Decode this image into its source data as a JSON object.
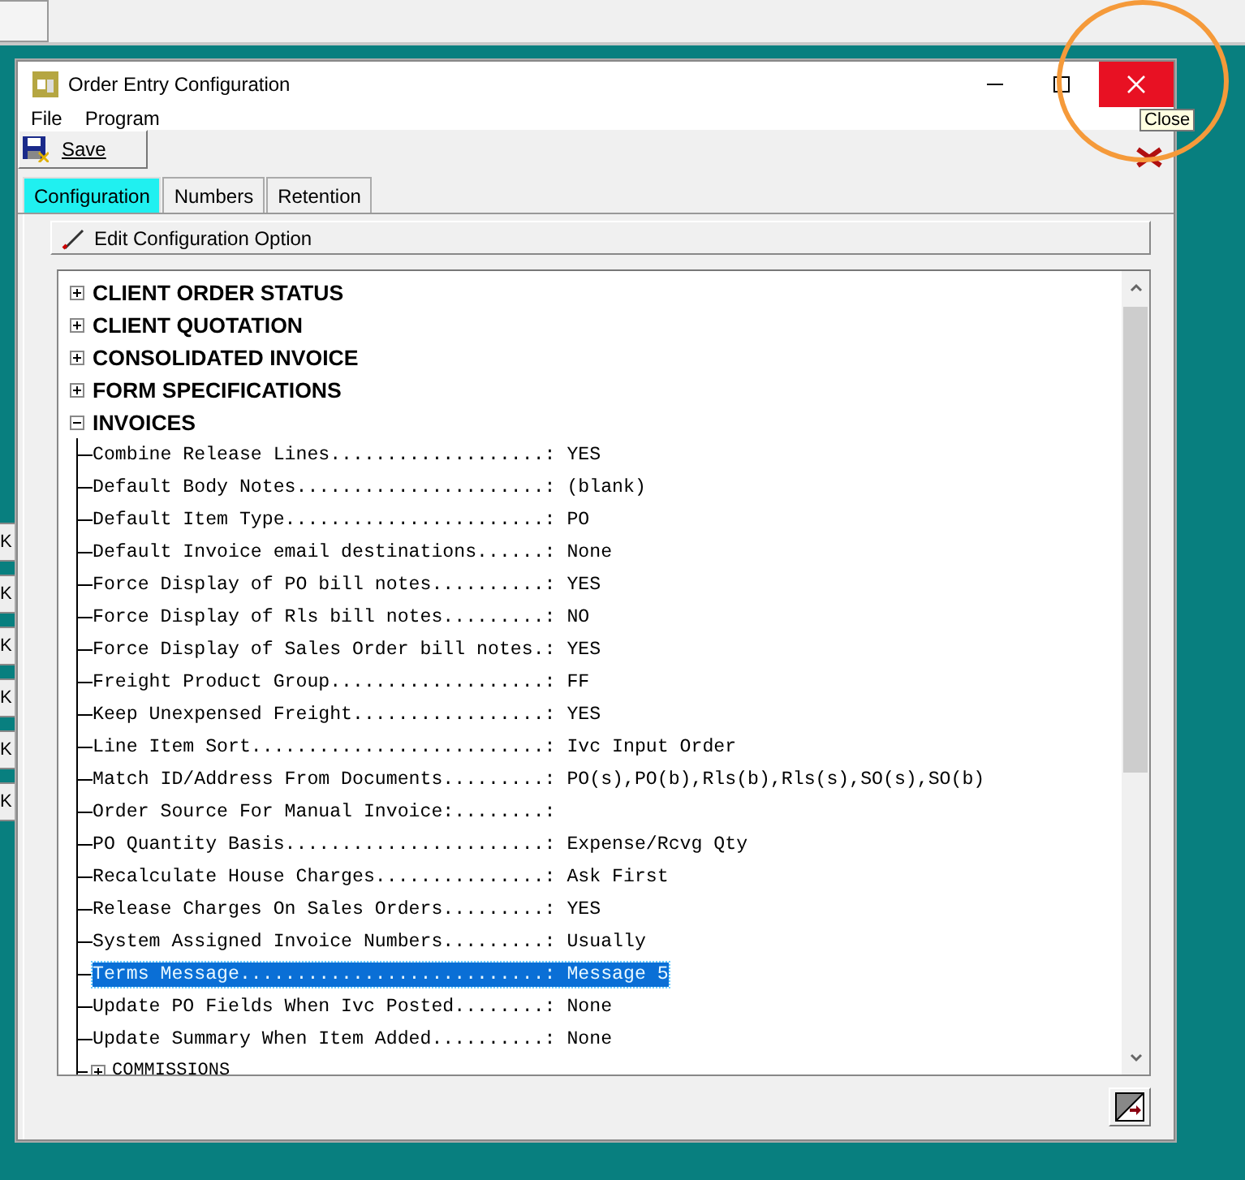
{
  "window": {
    "title": "Order Entry Configuration",
    "close_tooltip": "Close"
  },
  "menu": [
    "File",
    "Program"
  ],
  "toolbar": {
    "save": "Save"
  },
  "tabs": [
    {
      "label": "Configuration",
      "selected": true
    },
    {
      "label": "Numbers",
      "selected": false
    },
    {
      "label": "Retention",
      "selected": false
    }
  ],
  "edit_button": "Edit Configuration Option",
  "background_buttons": [
    "K",
    "K",
    "K",
    "K",
    "K",
    "K"
  ],
  "tree": [
    {
      "kind": "group",
      "label": "CLIENT ORDER STATUS",
      "expanded": false
    },
    {
      "kind": "group",
      "label": "CLIENT QUOTATION",
      "expanded": false
    },
    {
      "kind": "group",
      "label": "CONSOLIDATED INVOICE",
      "expanded": false
    },
    {
      "kind": "group",
      "label": "FORM SPECIFICATIONS",
      "expanded": false
    },
    {
      "kind": "group",
      "label": "INVOICES",
      "expanded": true,
      "children": [
        {
          "kind": "setting",
          "label": "Combine Release Lines...................: YES",
          "selected": false
        },
        {
          "kind": "setting",
          "label": "Default Body Notes......................: (blank)",
          "selected": false
        },
        {
          "kind": "setting",
          "label": "Default Item Type.......................: PO",
          "selected": false
        },
        {
          "kind": "setting",
          "label": "Default Invoice email destinations......: None",
          "selected": false
        },
        {
          "kind": "setting",
          "label": "Force Display of PO bill notes..........: YES",
          "selected": false
        },
        {
          "kind": "setting",
          "label": "Force Display of Rls bill notes.........: NO",
          "selected": false
        },
        {
          "kind": "setting",
          "label": "Force Display of Sales Order bill notes.: YES",
          "selected": false
        },
        {
          "kind": "setting",
          "label": "Freight Product Group...................: FF",
          "selected": false
        },
        {
          "kind": "setting",
          "label": "Keep Unexpensed Freight.................: YES",
          "selected": false
        },
        {
          "kind": "setting",
          "label": "Line Item Sort..........................: Ivc Input Order",
          "selected": false
        },
        {
          "kind": "setting",
          "label": "Match ID/Address From Documents.........: PO(s),PO(b),Rls(b),Rls(s),SO(s),SO(b)",
          "selected": false
        },
        {
          "kind": "setting",
          "label": "Order Source For Manual Invoice:........:",
          "selected": false
        },
        {
          "kind": "setting",
          "label": "PO Quantity Basis.......................: Expense/Rcvg Qty",
          "selected": false
        },
        {
          "kind": "setting",
          "label": "Recalculate House Charges...............: Ask First",
          "selected": false
        },
        {
          "kind": "setting",
          "label": "Release Charges On Sales Orders.........: YES",
          "selected": false
        },
        {
          "kind": "setting",
          "label": "System Assigned Invoice Numbers.........: Usually",
          "selected": false
        },
        {
          "kind": "setting",
          "label": "Terms Message...........................: Message 5",
          "selected": true
        },
        {
          "kind": "setting",
          "label": "Update PO Fields When Ivc Posted........: None",
          "selected": false
        },
        {
          "kind": "setting",
          "label": "Update Summary When Item Added..........: None",
          "selected": false
        },
        {
          "kind": "group",
          "label": "COMMISSIONS",
          "expanded": false
        }
      ]
    }
  ]
}
